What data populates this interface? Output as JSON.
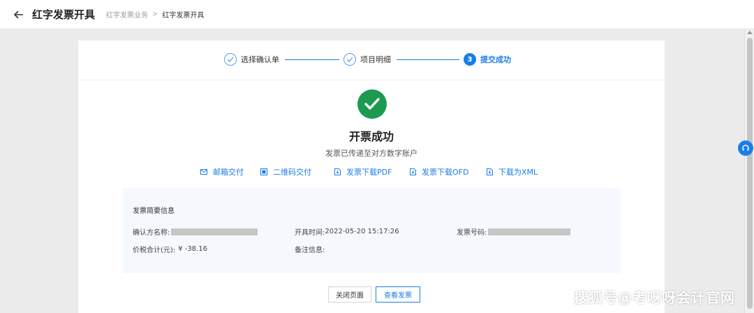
{
  "header": {
    "title": "红字发票开具",
    "breadcrumb": [
      "红字发票业务",
      "红字发票开具"
    ],
    "breadcrumb_sep": ">"
  },
  "steps": [
    {
      "label": "选择确认单",
      "state": "done"
    },
    {
      "label": "项目明细",
      "state": "done"
    },
    {
      "label": "提交成功",
      "state": "active",
      "number": "3"
    }
  ],
  "result": {
    "title": "开票成功",
    "subtitle": "发票已传递至对方数字账户"
  },
  "actions": [
    {
      "label": "邮箱交付",
      "icon": "mail-icon"
    },
    {
      "label": "二维码交付",
      "icon": "qrcode-icon"
    },
    {
      "label": "发票下载PDF",
      "icon": "download-icon"
    },
    {
      "label": "发票下载OFD",
      "icon": "download-icon"
    },
    {
      "label": "下载为XML",
      "icon": "download-icon"
    }
  ],
  "info": {
    "title": "发票简要信息",
    "buyer_label": "确认方名称:",
    "time_label": "开具时间:",
    "time_value": "2022-05-20 15:17:26",
    "number_label": "发票号码:",
    "total_label": "价税合计(元):",
    "total_value": "¥ -38.16",
    "remark_label": "备注信息:"
  },
  "buttons": {
    "close": "关闭页面",
    "view": "查看发票"
  },
  "watermark": "搜狐号@考呀呀会计官网",
  "colors": {
    "primary": "#1a7ee8",
    "success": "#1d9a52"
  }
}
